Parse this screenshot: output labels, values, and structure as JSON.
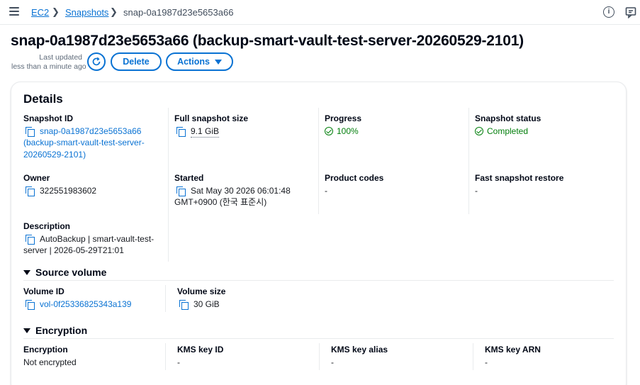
{
  "breadcrumb": {
    "items": [
      "EC2",
      "Snapshots",
      "snap-0a1987d23e5653a66"
    ]
  },
  "header": {
    "title": "snap-0a1987d23e5653a66 (backup-smart-vault-test-server-20260529-2101)",
    "last_updated_label": "Last updated",
    "last_updated_value": "less than a minute ago",
    "delete_label": "Delete",
    "actions_label": "Actions"
  },
  "details": {
    "title": "Details",
    "snapshot_id": {
      "label": "Snapshot ID",
      "line1": "snap-0a1987d23e5653a66",
      "line2": "(backup-smart-vault-test-server-",
      "line3": "20260529-2101)"
    },
    "full_snapshot_size": {
      "label": "Full snapshot size",
      "value": "9.1 GiB"
    },
    "progress": {
      "label": "Progress",
      "value": "100%"
    },
    "snapshot_status": {
      "label": "Snapshot status",
      "value": "Completed"
    },
    "owner": {
      "label": "Owner",
      "value": "322551983602"
    },
    "started": {
      "label": "Started",
      "line1": "Sat May 30 2026 06:01:48",
      "line2": "GMT+0900 (한국 표준시)"
    },
    "product_codes": {
      "label": "Product codes",
      "value": "-"
    },
    "fast_snapshot_restore": {
      "label": "Fast snapshot restore",
      "value": "-"
    },
    "description": {
      "label": "Description",
      "line1": "AutoBackup | smart-vault-test-",
      "line2": "server | 2026-05-29T21:01"
    }
  },
  "source_volume": {
    "title": "Source volume",
    "volume_id": {
      "label": "Volume ID",
      "value": "vol-0f25336825343a139"
    },
    "volume_size": {
      "label": "Volume size",
      "value": "30 GiB"
    }
  },
  "encryption": {
    "title": "Encryption",
    "encryption": {
      "label": "Encryption",
      "value": "Not encrypted"
    },
    "kms_key_id": {
      "label": "KMS key ID",
      "value": "-"
    },
    "kms_key_alias": {
      "label": "KMS key alias",
      "value": "-"
    },
    "kms_key_arn": {
      "label": "KMS key ARN",
      "value": "-"
    }
  },
  "colors": {
    "link": "#0972d3",
    "success": "#037f0c",
    "text": "#16191f"
  },
  "icons": [
    "menu-icon",
    "chevron-right-icon",
    "info-icon",
    "feedback-icon",
    "refresh-icon",
    "copy-icon",
    "check-circle-icon",
    "caret-down-icon"
  ]
}
